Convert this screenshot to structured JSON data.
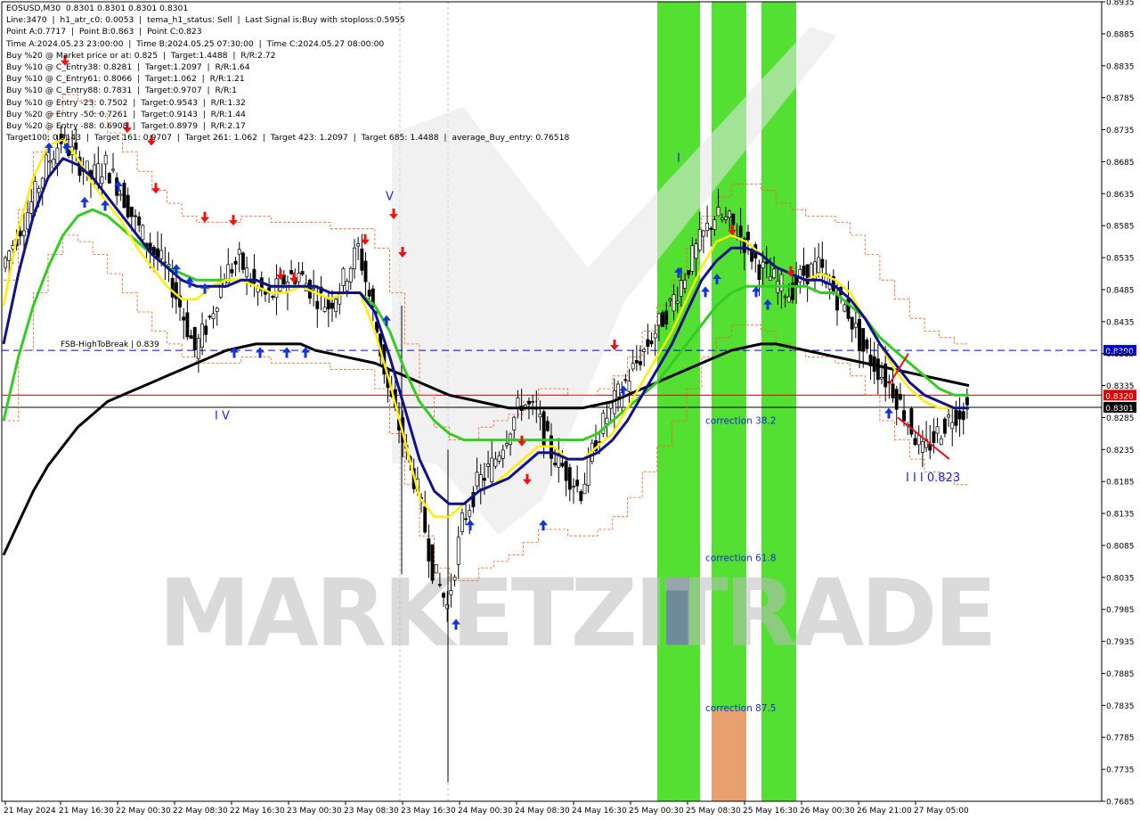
{
  "chart_data": {
    "type": "candlestick",
    "symbol": "EOSUSD,M30",
    "ohlc": "0.8301 0.8301 0.8301 0.8301",
    "watermark": "MARKETZITRADE",
    "info_lines": [
      "EOSUSD,M30  0.8301 0.8301 0.8301 0.8301",
      "Line:3470  |  h1_atr_c0: 0.0053  |  tema_h1_status: Sell  |  Last Signal is:Buy with stoploss:0.5955",
      "Point A:0.7717  |  Point B:0.863  |  Point C:0.823",
      "Time A:2024.05.23 23:00:00  |  Time B:2024.05.25 07:30:00  |  Time C:2024.05.27 08:00:00",
      "Buy %20 @ Market price or at: 0.825  |  Target:1.4488  |  R/R:2.72",
      "Buy %10 @ C_Entry38: 0.8281  |  Target:1.2097  |  R/R:1.64",
      "Buy %10 @ C_Entry61: 0.8066  |  Target:1.062  |  R/R:1.21",
      "Buy %10 @ C_Entry88: 0.7831  |  Target:0.9707  |  R/R:1",
      "Buy %10 @ Entry -23: 0.7502  |  Target:0.9543  |  R/R:1.32",
      "Buy %20 @ Entry -50: 0.7261  |  Target:0.9143  |  R/R:1.44",
      "Buy %20 @ Entry -88: 0.6908  |  Target:0.8979  |  R/R:2.17",
      "Target100: 0.9143  |  Target 161: 0.9707  |  Target 261: 1.062  |  Target 423: 1.2097  |  Target 685: 1.4488  |  average_Buy_entry: 0.76518"
    ],
    "ylim": [
      0.7685,
      0.8935
    ],
    "yticks": [
      "0.8935",
      "0.8885",
      "0.8835",
      "0.8785",
      "0.8735",
      "0.8685",
      "0.8635",
      "0.8585",
      "0.8535",
      "0.8485",
      "0.8435",
      "0.8385",
      "0.8335",
      "0.8285",
      "0.8235",
      "0.8185",
      "0.8135",
      "0.8085",
      "0.8035",
      "0.7985",
      "0.7935",
      "0.7885",
      "0.7835",
      "0.7785",
      "0.7735",
      "0.7685"
    ],
    "xticks": [
      "21 May 2024",
      "21 May 16:30",
      "22 May 00:30",
      "22 May 08:30",
      "22 May 16:30",
      "23 May 00:30",
      "23 May 08:30",
      "23 May 16:30",
      "24 May 00:30",
      "24 May 08:30",
      "24 May 16:30",
      "25 May 00:30",
      "25 May 08:30",
      "25 May 16:30",
      "26 May 00:30",
      "26 May 21:00",
      "27 May 05:00"
    ],
    "horizontal_lines": [
      {
        "label": "FSB-HighToBreak | 0.839",
        "value": 0.839,
        "tag": "0.8390",
        "color": "#0000cd",
        "style": "dashed"
      },
      {
        "label": "",
        "value": 0.832,
        "tag": "0.8320",
        "color": "#e00000",
        "style": "solid"
      },
      {
        "label": "",
        "value": 0.8301,
        "tag": "0.8301",
        "color": "#000000",
        "style": "solid"
      }
    ],
    "corrections": [
      {
        "label": "correction 38.2",
        "value": 0.8281
      },
      {
        "label": "correction 61.8",
        "value": 0.8066
      },
      {
        "label": "correction 87.5",
        "value": 0.7831
      }
    ],
    "wave_labels": [
      "I V",
      "V",
      "I",
      "I I I 0.823"
    ],
    "price_series": [
      0.852,
      0.857,
      0.862,
      0.868,
      0.872,
      0.869,
      0.866,
      0.868,
      0.864,
      0.859,
      0.855,
      0.852,
      0.846,
      0.839,
      0.844,
      0.851,
      0.853,
      0.849,
      0.847,
      0.85,
      0.851,
      0.848,
      0.846,
      0.85,
      0.855,
      0.845,
      0.833,
      0.825,
      0.817,
      0.805,
      0.799,
      0.812,
      0.818,
      0.821,
      0.826,
      0.831,
      0.829,
      0.823,
      0.82,
      0.817,
      0.825,
      0.83,
      0.834,
      0.838,
      0.842,
      0.846,
      0.851,
      0.856,
      0.86,
      0.859,
      0.856,
      0.852,
      0.85,
      0.848,
      0.851,
      0.852,
      0.848,
      0.845,
      0.839,
      0.836,
      0.833,
      0.828,
      0.823,
      0.826,
      0.829,
      0.83
    ],
    "ema_yellow": [
      0.846,
      0.858,
      0.866,
      0.871,
      0.872,
      0.869,
      0.865,
      0.862,
      0.859,
      0.855,
      0.852,
      0.849,
      0.847,
      0.847,
      0.849,
      0.85,
      0.85,
      0.849,
      0.848,
      0.848,
      0.849,
      0.848,
      0.847,
      0.848,
      0.848,
      0.842,
      0.834,
      0.825,
      0.816,
      0.813,
      0.813,
      0.815,
      0.817,
      0.818,
      0.82,
      0.822,
      0.824,
      0.824,
      0.822,
      0.822,
      0.824,
      0.826,
      0.83,
      0.834,
      0.838,
      0.842,
      0.847,
      0.852,
      0.856,
      0.857,
      0.856,
      0.854,
      0.852,
      0.851,
      0.85,
      0.851,
      0.85,
      0.848,
      0.844,
      0.84,
      0.836,
      0.833,
      0.831,
      0.83,
      0.83,
      0.83
    ],
    "ema_navy": [
      0.84,
      0.851,
      0.86,
      0.866,
      0.869,
      0.868,
      0.866,
      0.863,
      0.86,
      0.857,
      0.854,
      0.852,
      0.85,
      0.849,
      0.849,
      0.849,
      0.85,
      0.85,
      0.849,
      0.849,
      0.849,
      0.849,
      0.848,
      0.848,
      0.848,
      0.845,
      0.838,
      0.83,
      0.822,
      0.817,
      0.815,
      0.815,
      0.817,
      0.818,
      0.819,
      0.821,
      0.823,
      0.823,
      0.822,
      0.822,
      0.823,
      0.825,
      0.828,
      0.832,
      0.836,
      0.84,
      0.845,
      0.85,
      0.853,
      0.855,
      0.855,
      0.854,
      0.852,
      0.851,
      0.85,
      0.85,
      0.849,
      0.847,
      0.844,
      0.84,
      0.837,
      0.834,
      0.832,
      0.831,
      0.83,
      0.83
    ],
    "ema_green": [
      0.828,
      0.838,
      0.846,
      0.852,
      0.857,
      0.86,
      0.861,
      0.86,
      0.858,
      0.856,
      0.854,
      0.852,
      0.851,
      0.85,
      0.85,
      0.85,
      0.85,
      0.85,
      0.849,
      0.849,
      0.849,
      0.849,
      0.848,
      0.848,
      0.848,
      0.846,
      0.842,
      0.836,
      0.831,
      0.828,
      0.826,
      0.825,
      0.825,
      0.825,
      0.825,
      0.825,
      0.825,
      0.825,
      0.825,
      0.825,
      0.826,
      0.828,
      0.83,
      0.832,
      0.834,
      0.837,
      0.84,
      0.843,
      0.846,
      0.848,
      0.849,
      0.849,
      0.849,
      0.849,
      0.849,
      0.848,
      0.848,
      0.846,
      0.844,
      0.841,
      0.839,
      0.837,
      0.835,
      0.833,
      0.832,
      0.832
    ],
    "ema_black": [
      0.807,
      0.812,
      0.817,
      0.821,
      0.824,
      0.827,
      0.829,
      0.831,
      0.832,
      0.833,
      0.834,
      0.835,
      0.836,
      0.837,
      0.838,
      0.839,
      0.8395,
      0.84,
      0.84,
      0.84,
      0.84,
      0.839,
      0.8385,
      0.838,
      0.8375,
      0.837,
      0.836,
      0.835,
      0.834,
      0.833,
      0.832,
      0.8315,
      0.831,
      0.8305,
      0.83,
      0.83,
      0.83,
      0.83,
      0.83,
      0.83,
      0.8305,
      0.831,
      0.832,
      0.833,
      0.834,
      0.835,
      0.836,
      0.837,
      0.838,
      0.839,
      0.8395,
      0.84,
      0.84,
      0.8395,
      0.839,
      0.8385,
      0.838,
      0.8375,
      0.837,
      0.8365,
      0.836,
      0.8355,
      0.835,
      0.8345,
      0.834,
      0.8335
    ]
  },
  "price_tags": {
    "fsb": "0.8390",
    "red": "0.8320",
    "current": "0.8301"
  },
  "fsb_label": "FSB-HighToBreak | 0.839"
}
